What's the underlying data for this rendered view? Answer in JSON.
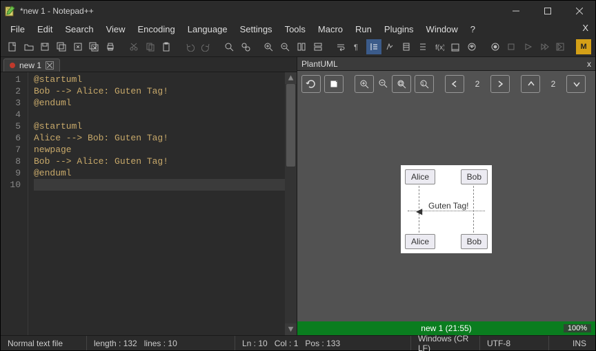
{
  "window": {
    "title": "*new 1 - Notepad++"
  },
  "menu": {
    "items": [
      "File",
      "Edit",
      "Search",
      "View",
      "Encoding",
      "Language",
      "Settings",
      "Tools",
      "Macro",
      "Run",
      "Plugins",
      "Window",
      "?"
    ]
  },
  "tab": {
    "label": "new 1"
  },
  "editor": {
    "lines": [
      "@startuml",
      "Bob --> Alice: Guten Tag!",
      "@enduml",
      "",
      "@startuml",
      "Alice --> Bob: Guten Tag!",
      "newpage",
      "Bob --> Alice: Guten Tag!",
      "@enduml",
      ""
    ],
    "line_numbers": [
      "1",
      "2",
      "3",
      "4",
      "5",
      "6",
      "7",
      "8",
      "9",
      "10"
    ],
    "current_line_index": 9
  },
  "plantuml": {
    "panel_title": "PlantUML",
    "nav1_page": "2",
    "nav2_page": "2",
    "actors": {
      "a": "Alice",
      "b": "Bob"
    },
    "message_label": "Guten Tag!",
    "status": "new 1 (21:55)",
    "zoom": "100%"
  },
  "status": {
    "filetype": "Normal text file",
    "length_label": "length : 132",
    "lines_label": "lines : 10",
    "ln_label": "Ln : 10",
    "col_label": "Col : 1",
    "pos_label": "Pos : 133",
    "eol": "Windows (CR LF)",
    "encoding": "UTF-8",
    "mode": "INS"
  }
}
